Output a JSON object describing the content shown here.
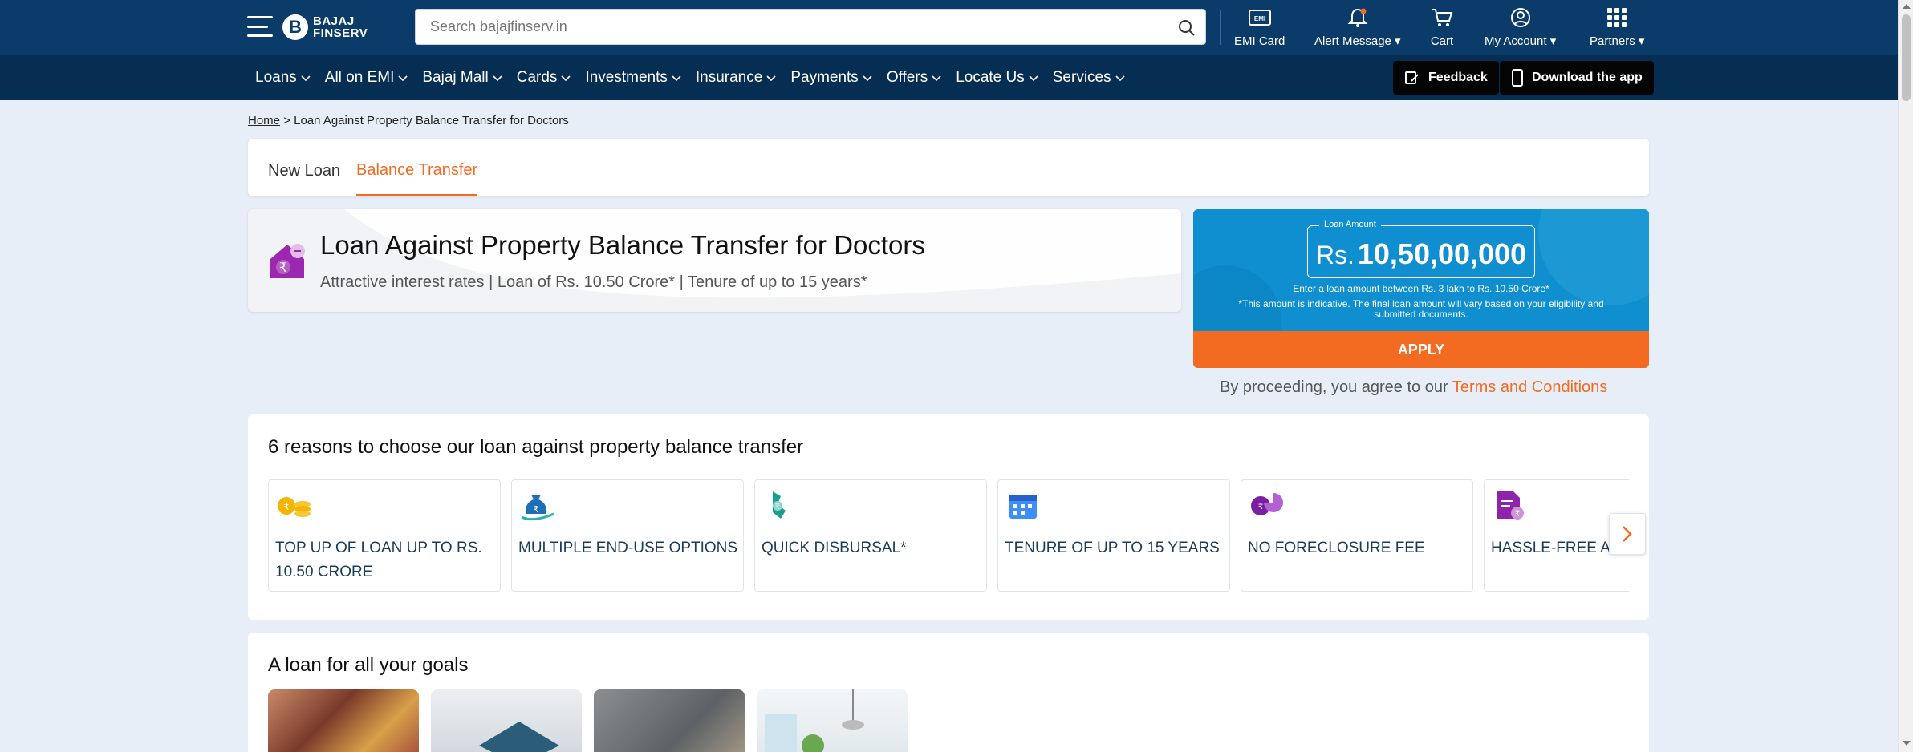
{
  "header": {
    "brand_line1": "BAJAJ",
    "brand_line2": "FINSERV",
    "search_placeholder": "Search bajajfinserv.in",
    "emi_card": "EMI Card",
    "emi_badge": "EMI",
    "alert": "Alert Message",
    "cart": "Cart",
    "account": "My Account",
    "partners": "Partners"
  },
  "nav": {
    "items": [
      "Loans",
      "All on EMI",
      "Bajaj Mall",
      "Cards",
      "Investments",
      "Insurance",
      "Payments",
      "Offers",
      "Locate Us",
      "Services"
    ],
    "feedback": "Feedback",
    "download": "Download the app"
  },
  "breadcrumb": {
    "home": "Home",
    "sep": ">",
    "current": "Loan Against Property Balance Transfer for Doctors"
  },
  "tabs": [
    "New Loan",
    "Balance Transfer"
  ],
  "hero": {
    "title": "Loan Against Property Balance Transfer for Doctors",
    "subtitle": "Attractive interest rates | Loan of Rs. 10.50 Crore* | Tenure of up to 15 years*"
  },
  "loan_widget": {
    "label": "Loan Amount",
    "currency": "Rs.",
    "amount": "10,50,00,000",
    "range_note": "Enter a loan amount between Rs. 3 lakh to Rs. 10.50 Crore*",
    "disclaimer": "*This amount is indicative. The final loan amount will vary based on your eligibility and submitted documents.",
    "apply": "APPLY",
    "accent": "#f26b21",
    "bg": "#0f8fcf"
  },
  "terms": {
    "prefix": "By proceeding, you agree to our",
    "link": "Terms and Conditions"
  },
  "reasons": {
    "title": "6 reasons to choose our loan against property balance transfer",
    "cards": [
      {
        "line1": "TOP UP OF LOAN UP TO RS.",
        "line2": "10.50 CRORE",
        "icon": "coins-icon"
      },
      {
        "line1": "MULTIPLE END-USE OPTIONS",
        "line2": "",
        "icon": "money-bag-icon"
      },
      {
        "line1": "QUICK DISBURSAL*",
        "line2": "",
        "icon": "hand-money-icon"
      },
      {
        "line1": "TENURE OF UP TO 15 YEARS",
        "line2": "",
        "icon": "calendar-icon"
      },
      {
        "line1": "NO FORECLOSURE FEE",
        "line2": "",
        "icon": "pie-rupee-icon"
      },
      {
        "line1": "HASSLE-FREE A",
        "line2": "",
        "icon": "document-rupee-icon"
      }
    ]
  },
  "goals": {
    "title": "A loan for all your goals"
  }
}
